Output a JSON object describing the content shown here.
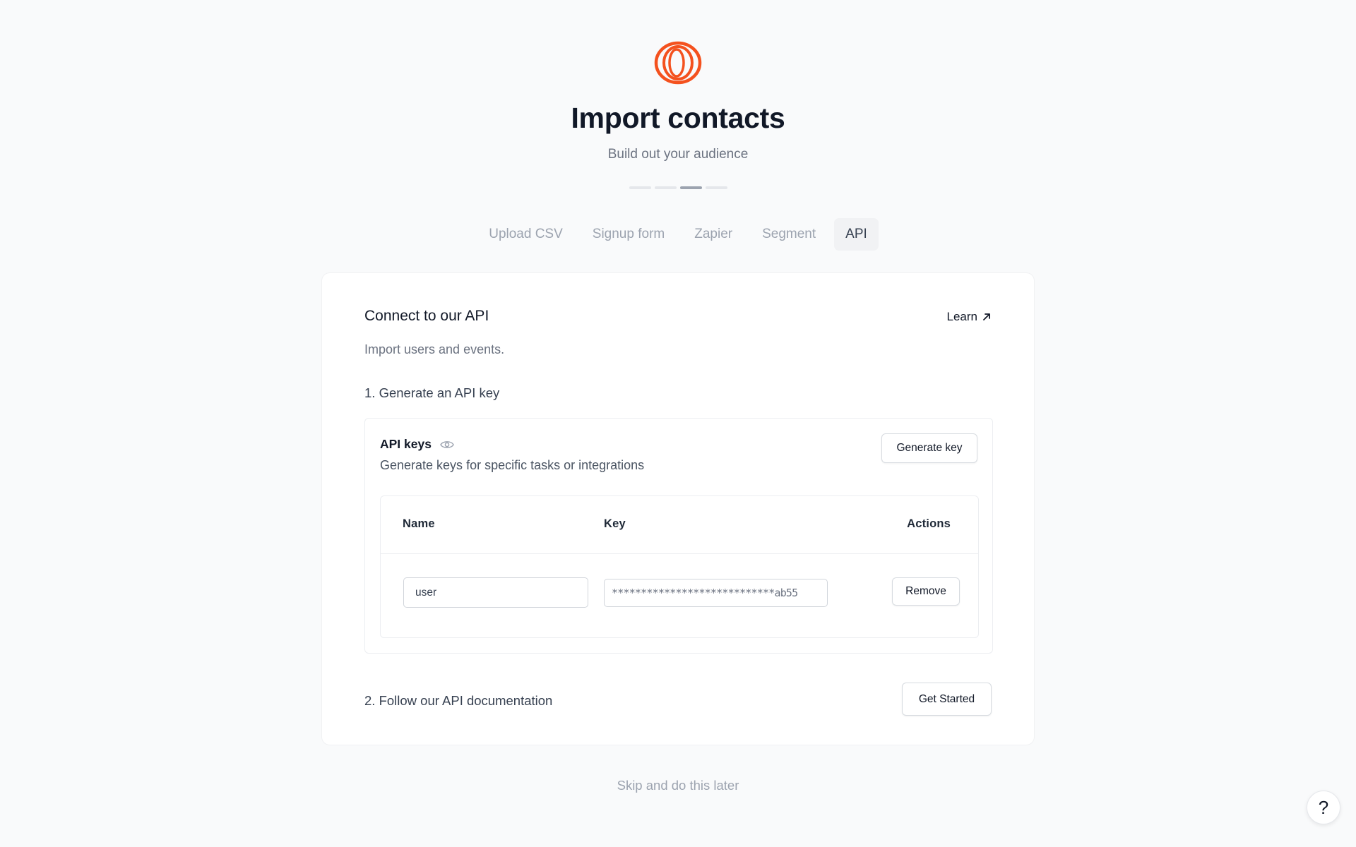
{
  "brand": {
    "logo_icon": "orange-rings-logo",
    "accent_color": "#f4511e"
  },
  "header": {
    "title": "Import contacts",
    "subtitle": "Build out your audience"
  },
  "progress": {
    "total_steps": 4,
    "current_step": 3
  },
  "tabs": [
    {
      "label": "Upload CSV",
      "active": false
    },
    {
      "label": "Signup form",
      "active": false
    },
    {
      "label": "Zapier",
      "active": false
    },
    {
      "label": "Segment",
      "active": false
    },
    {
      "label": "API",
      "active": true
    }
  ],
  "card": {
    "title": "Connect to our API",
    "learn_label": "Learn",
    "description": "Import users and events.",
    "step1_label": "1. Generate an API key",
    "step2_label": "2. Follow our API documentation",
    "get_started_label": "Get Started"
  },
  "api_keys": {
    "title": "API keys",
    "description": "Generate keys for specific tasks or integrations",
    "generate_label": "Generate key",
    "columns": {
      "name": "Name",
      "key": "Key",
      "actions": "Actions"
    },
    "rows": [
      {
        "name": "user",
        "key": "****************************ab55",
        "action_label": "Remove"
      }
    ]
  },
  "footer": {
    "skip_label": "Skip and do this later",
    "help_label": "?"
  }
}
